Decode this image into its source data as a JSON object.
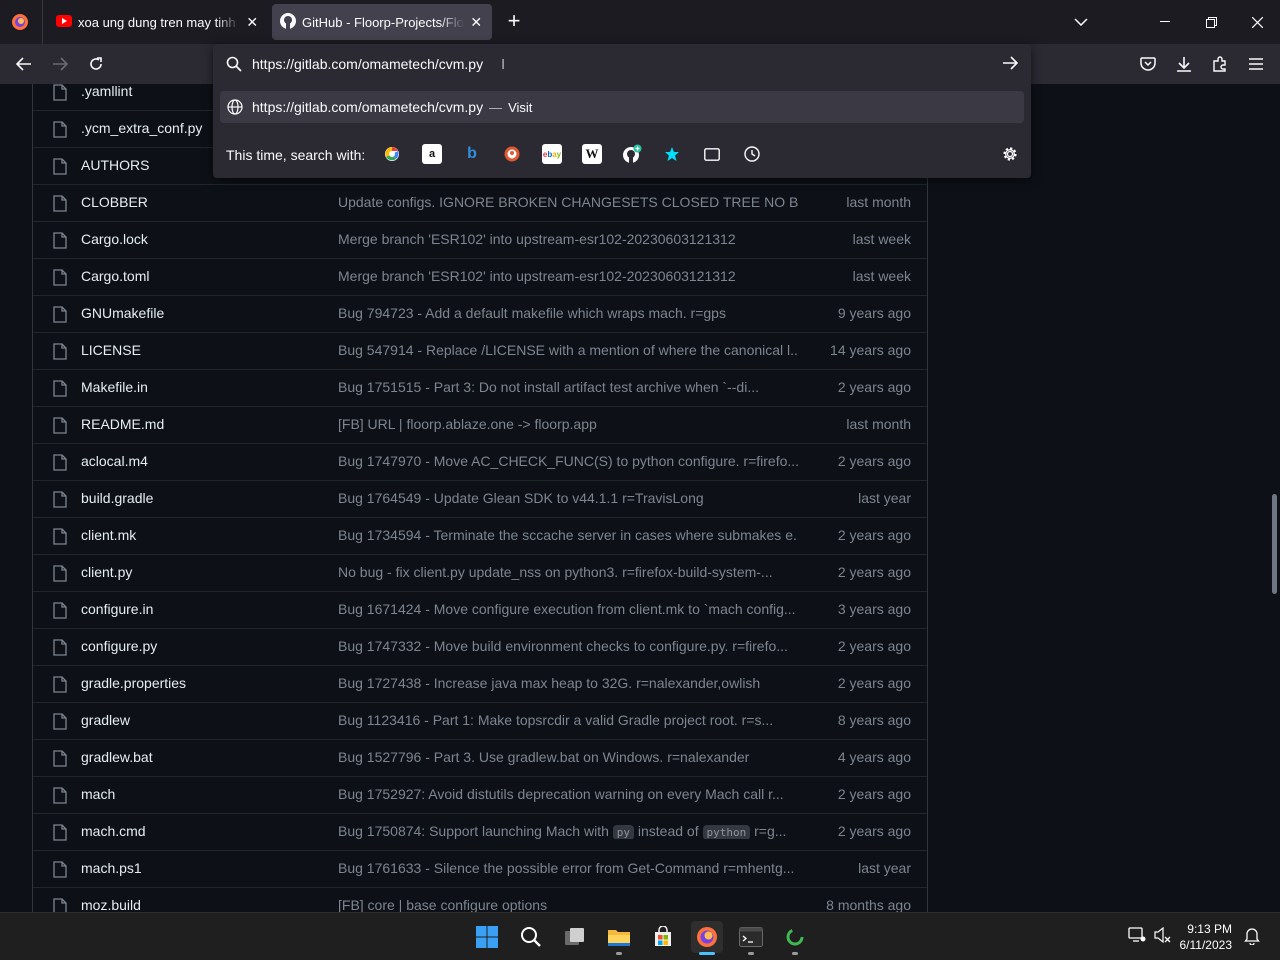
{
  "browser": {
    "tabs": [
      {
        "title": "xoa ung dung tren may tinh win",
        "icon": "youtube-icon",
        "active": false
      },
      {
        "title": "GitHub - Floorp-Projects/Floorp",
        "icon": "github-icon",
        "active": true
      }
    ],
    "new_tab": "+",
    "url": "https://gitlab.com/omametech/cvm.py",
    "suggestion": {
      "url": "https://gitlab.com/omametech/cvm.py",
      "separator": "—",
      "action": "Visit"
    },
    "search_with_label": "This time, search with:",
    "engines": [
      "google",
      "amazon",
      "bing",
      "duckduckgo",
      "ebay",
      "wikipedia",
      "github",
      "bookmarks",
      "tabs",
      "history"
    ]
  },
  "files": [
    {
      "name": ".yamllint",
      "message": "",
      "age": ""
    },
    {
      "name": ".ycm_extra_conf.py",
      "message": "",
      "age": ""
    },
    {
      "name": "AUTHORS",
      "message": "",
      "age": ""
    },
    {
      "name": "CLOBBER",
      "message": "Update configs. IGNORE BROKEN CHANGESETS CLOSED TREE NO BUG ...",
      "age": "last month"
    },
    {
      "name": "Cargo.lock",
      "message": "Merge branch 'ESR102' into upstream-esr102-20230603121312",
      "age": "last week"
    },
    {
      "name": "Cargo.toml",
      "message": "Merge branch 'ESR102' into upstream-esr102-20230603121312",
      "age": "last week"
    },
    {
      "name": "GNUmakefile",
      "message": "Bug 794723 - Add a default makefile which wraps mach. r=gps",
      "age": "9 years ago"
    },
    {
      "name": "LICENSE",
      "message": "Bug 547914 - Replace /LICENSE with a mention of where the canonical l...",
      "age": "14 years ago"
    },
    {
      "name": "Makefile.in",
      "message": "Bug 1751515 - Part 3: Do not install artifact test archive when `--di...",
      "age": "2 years ago"
    },
    {
      "name": "README.md",
      "message": "[FB] URL | floorp.ablaze.one -> floorp.app",
      "age": "last month"
    },
    {
      "name": "aclocal.m4",
      "message": "Bug 1747970 - Move AC_CHECK_FUNC(S) to python configure. r=firefo...",
      "age": "2 years ago"
    },
    {
      "name": "build.gradle",
      "message": "Bug 1764549 - Update Glean SDK to v44.1.1 r=TravisLong",
      "age": "last year"
    },
    {
      "name": "client.mk",
      "message": "Bug 1734594 - Terminate the sccache server in cases where submakes e...",
      "age": "2 years ago"
    },
    {
      "name": "client.py",
      "message": "No bug - fix client.py update_nss on python3. r=firefox-build-system-...",
      "age": "2 years ago"
    },
    {
      "name": "configure.in",
      "message": "Bug 1671424 - Move configure execution from client.mk to `mach config...",
      "age": "3 years ago"
    },
    {
      "name": "configure.py",
      "message": "Bug 1747332 - Move build environment checks to configure.py. r=firefo...",
      "age": "2 years ago"
    },
    {
      "name": "gradle.properties",
      "message": "Bug 1727438 - Increase java max heap to 32G. r=nalexander,owlish",
      "age": "2 years ago"
    },
    {
      "name": "gradlew",
      "message": "Bug 1123416 - Part 1: Make topsrcdir a valid Gradle project root. r=s...",
      "age": "8 years ago"
    },
    {
      "name": "gradlew.bat",
      "message": "Bug 1527796 - Part 3. Use gradlew.bat on Windows. r=nalexander",
      "age": "4 years ago"
    },
    {
      "name": "mach",
      "message": "Bug 1752927: Avoid distutils deprecation warning on every Mach call r...",
      "age": "2 years ago"
    },
    {
      "name": "mach.cmd",
      "message": "",
      "message_parts": [
        "Bug 1750874: Support launching Mach with ",
        "py",
        " instead of ",
        "python",
        " r=g..."
      ],
      "age": "2 years ago"
    },
    {
      "name": "mach.ps1",
      "message": "Bug 1761633 - Silence the possible error from Get-Command r=mhentg...",
      "age": "last year"
    },
    {
      "name": "moz.build",
      "message": "[FB] core | base configure options",
      "age": "8 months ago"
    }
  ],
  "taskbar": {
    "apps": [
      "start",
      "search",
      "task-view",
      "file-explorer",
      "microsoft-store",
      "floorp",
      "terminal",
      "app"
    ],
    "time": "9:13 PM",
    "date": "6/11/2023"
  },
  "colors": {
    "accent": "#4cc2ff",
    "page_bg": "#0d1117",
    "muted_text": "#7d8590"
  }
}
